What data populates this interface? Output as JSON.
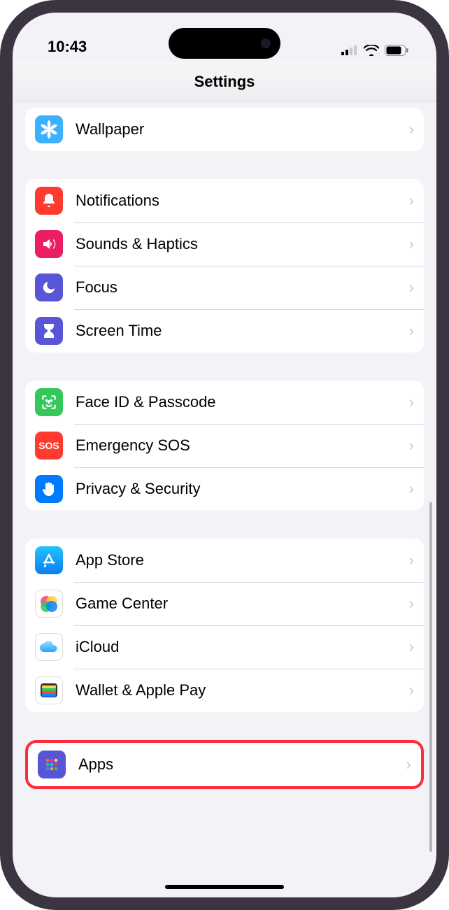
{
  "status": {
    "time": "10:43"
  },
  "header": {
    "title": "Settings"
  },
  "groups": [
    {
      "items": [
        {
          "name": "wallpaper",
          "label": "Wallpaper",
          "icon": "flower-icon",
          "bg": "#3fb0ff"
        }
      ]
    },
    {
      "items": [
        {
          "name": "notifications",
          "label": "Notifications",
          "icon": "bell-icon",
          "bg": "#ff3b30"
        },
        {
          "name": "sounds-haptics",
          "label": "Sounds & Haptics",
          "icon": "speaker-icon",
          "bg": "#ea1e63"
        },
        {
          "name": "focus",
          "label": "Focus",
          "icon": "moon-icon",
          "bg": "#5856d6"
        },
        {
          "name": "screen-time",
          "label": "Screen Time",
          "icon": "hourglass-icon",
          "bg": "#5856d6"
        }
      ]
    },
    {
      "items": [
        {
          "name": "face-id-passcode",
          "label": "Face ID & Passcode",
          "icon": "face-icon",
          "bg": "#34c759"
        },
        {
          "name": "emergency-sos",
          "label": "Emergency SOS",
          "icon": "sos-icon",
          "bg": "#ff3b30"
        },
        {
          "name": "privacy-security",
          "label": "Privacy & Security",
          "icon": "hand-icon",
          "bg": "#007aff"
        }
      ]
    },
    {
      "items": [
        {
          "name": "app-store",
          "label": "App Store",
          "icon": "appstore-icon",
          "bg": "#1fa7ff"
        },
        {
          "name": "game-center",
          "label": "Game Center",
          "icon": "gamecenter-icon",
          "bg": "#ffffff"
        },
        {
          "name": "icloud",
          "label": "iCloud",
          "icon": "icloud-icon",
          "bg": "#ffffff"
        },
        {
          "name": "wallet-apple-pay",
          "label": "Wallet & Apple Pay",
          "icon": "wallet-icon",
          "bg": "#ffffff"
        }
      ]
    },
    {
      "highlighted": true,
      "items": [
        {
          "name": "apps",
          "label": "Apps",
          "icon": "apps-icon",
          "bg": "#5856d6"
        }
      ]
    }
  ]
}
